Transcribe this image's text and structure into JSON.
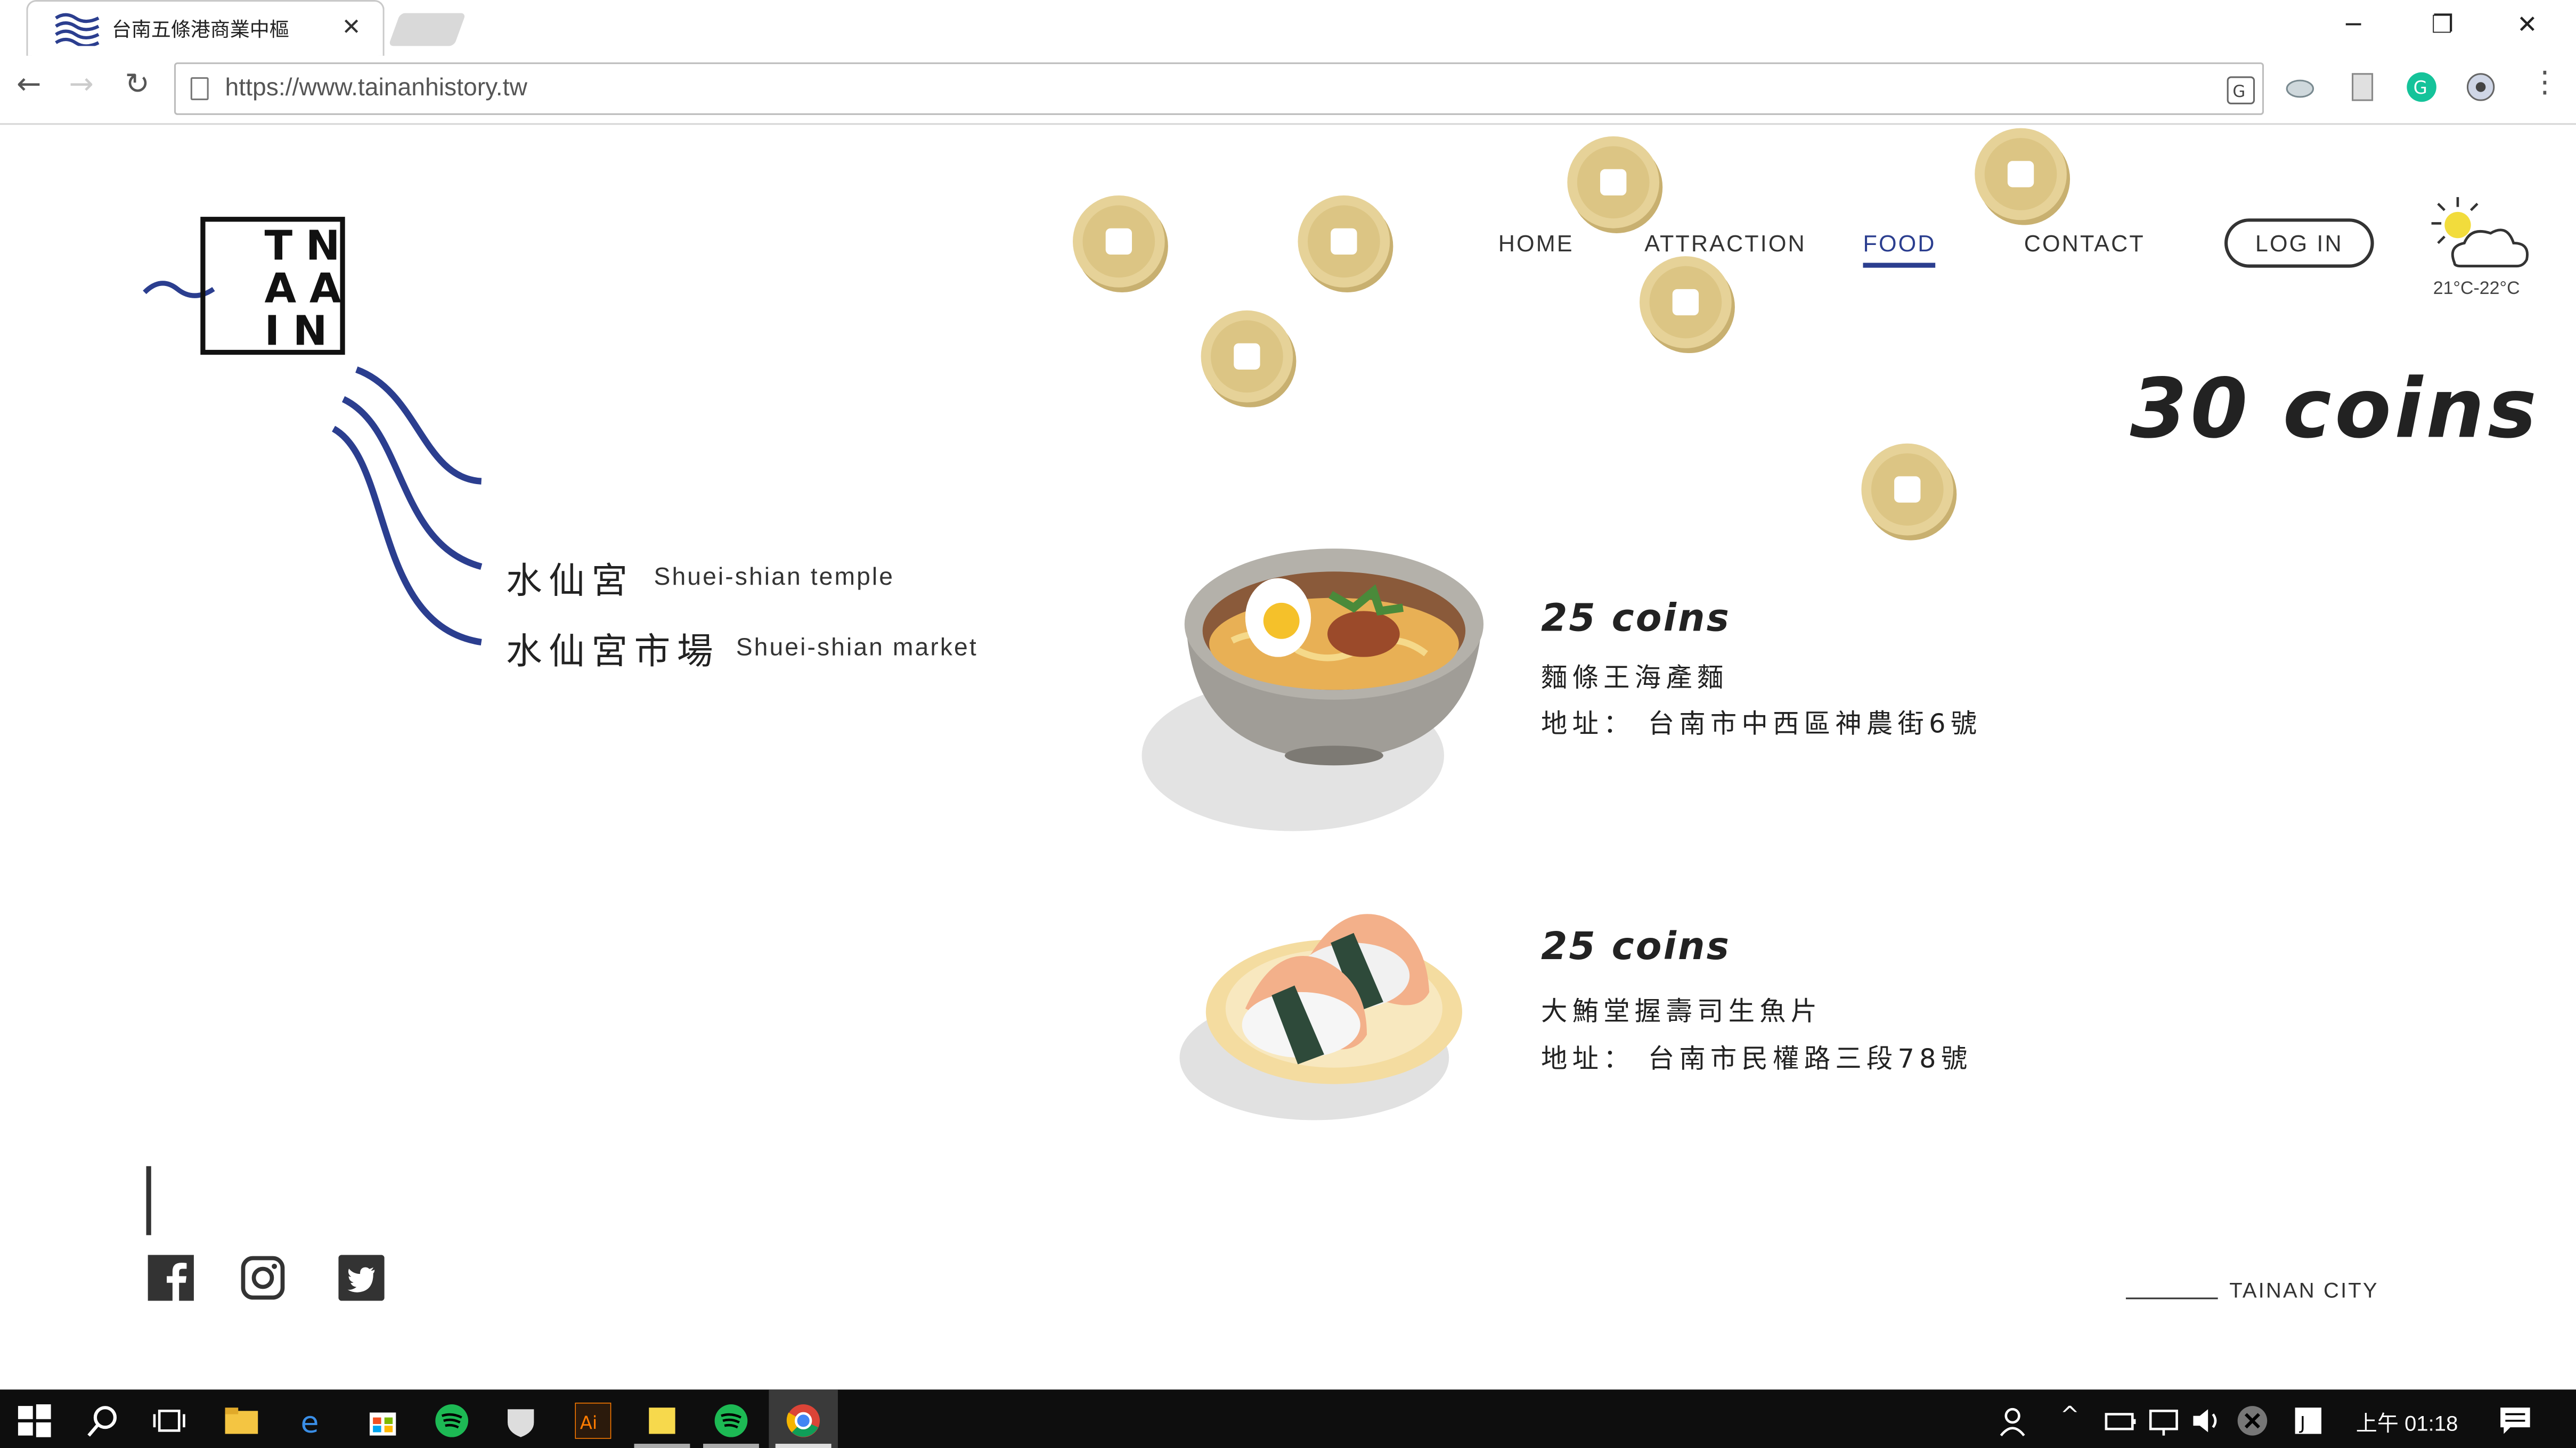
{
  "browser": {
    "tab_title": "台南五條港商業中樞",
    "tab_close": "✕",
    "url": "https://www.tainanhistory.tw",
    "window_controls": {
      "minimize": "─",
      "restore": "❐",
      "close": "✕"
    }
  },
  "logo": {
    "letters": "TN\nAA\nIN"
  },
  "nav": {
    "home": "HOME",
    "attraction": "ATTRACTION",
    "food": "FOOD",
    "contact": "CONTACT",
    "login": "LOG IN",
    "active": "FOOD"
  },
  "weather": {
    "temp": "21°C-22°C",
    "icon": "partly-cloudy-icon"
  },
  "coins_total": "30 coins",
  "locations": [
    {
      "cn": "水仙宮",
      "en": "Shuei-shian temple"
    },
    {
      "cn": "水仙宮市場",
      "en": "Shuei-shian market"
    }
  ],
  "food_items": [
    {
      "coins": "25 coins",
      "name": "麵條王海產麵",
      "address": "地址： 台南市中西區神農街6號",
      "icon": "noodle-bowl-icon"
    },
    {
      "coins": "25 coins",
      "name": "大鮪堂握壽司生魚片",
      "address": "地址： 台南市民權路三段78號",
      "icon": "sushi-plate-icon"
    }
  ],
  "footer": {
    "city": "TAINAN CITY",
    "social": [
      "facebook-icon",
      "instagram-icon",
      "twitter-icon"
    ]
  },
  "taskbar": {
    "clock": "上午 01:18"
  },
  "colors": {
    "accent": "#2b3e8f",
    "coin": "#e3cd8e",
    "text": "#222222"
  }
}
